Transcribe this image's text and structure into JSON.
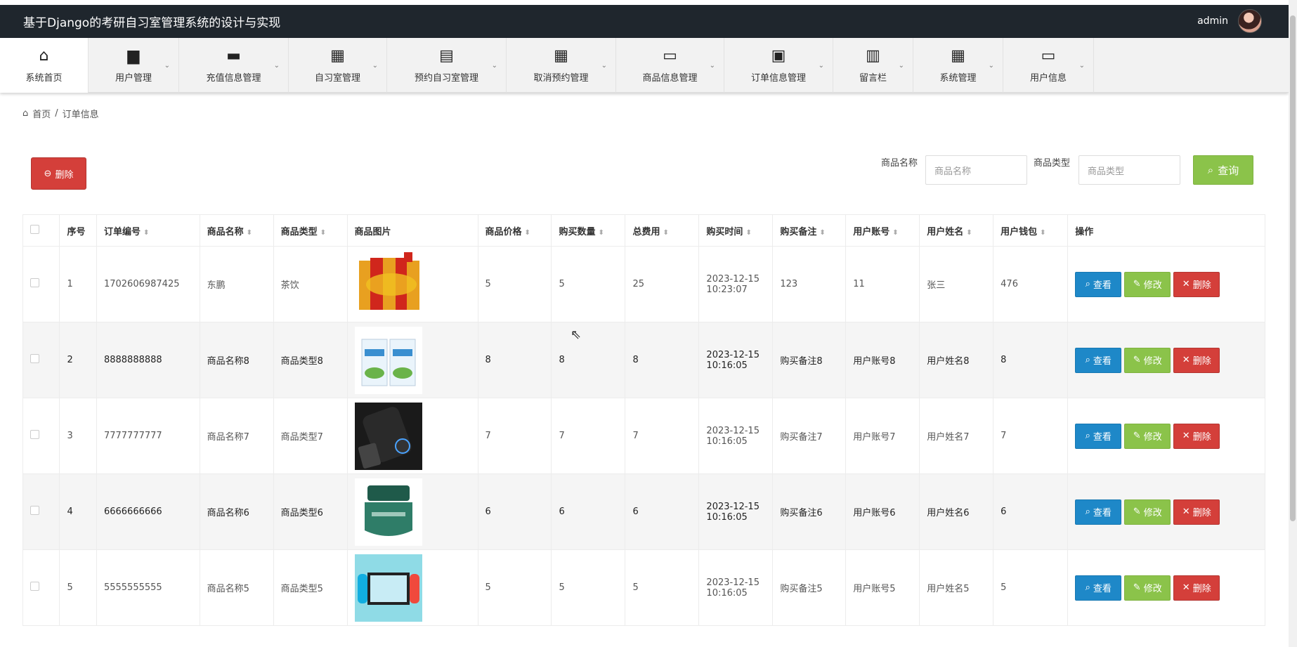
{
  "app": {
    "title": "基于Django的考研自习室管理系统的设计与实现",
    "user": "admin"
  },
  "nav": [
    {
      "label": "系统首页",
      "icon": "home-icon",
      "glyph": "⌂",
      "width": 126
    },
    {
      "label": "用户管理",
      "icon": "briefcase-icon",
      "glyph": "▆",
      "width": 129
    },
    {
      "label": "充值信息管理",
      "icon": "wallet-icon",
      "glyph": "▬",
      "width": 156
    },
    {
      "label": "自习室管理",
      "icon": "grid-icon",
      "glyph": "▦",
      "width": 140
    },
    {
      "label": "预约自习室管理",
      "icon": "clipboard-icon",
      "glyph": "▤",
      "width": 170
    },
    {
      "label": "取消预约管理",
      "icon": "grid-icon",
      "glyph": "▦",
      "width": 156
    },
    {
      "label": "商品信息管理",
      "icon": "chat-icon",
      "glyph": "▭",
      "width": 154
    },
    {
      "label": "订单信息管理",
      "icon": "clipboard-check-icon",
      "glyph": "▣",
      "width": 155
    },
    {
      "label": "留言栏",
      "icon": "book-icon",
      "glyph": "▥",
      "width": 114
    },
    {
      "label": "系统管理",
      "icon": "grid-icon",
      "glyph": "▦",
      "width": 128
    },
    {
      "label": "用户信息",
      "icon": "card-icon",
      "glyph": "▭",
      "width": 129
    }
  ],
  "breadcrumb": {
    "home": "首页",
    "sep": "/",
    "current": "订单信息"
  },
  "toolbar": {
    "delete_label": "删除",
    "delete_icon": "⊖"
  },
  "search": {
    "name_label": "商品名称",
    "name_placeholder": "商品名称",
    "type_label": "商品类型",
    "type_placeholder": "商品类型",
    "query_label": "查询"
  },
  "table": {
    "headers": [
      "序号",
      "订单编号",
      "商品名称",
      "商品类型",
      "商品图片",
      "商品价格",
      "购买数量",
      "总费用",
      "购买时间",
      "购买备注",
      "用户账号",
      "用户姓名",
      "用户钱包",
      "操作"
    ],
    "rows": [
      {
        "idx": "1",
        "order_no": "1702606987425",
        "name": "东鹏",
        "type": "茶饮",
        "price": "5",
        "qty": "5",
        "total": "25",
        "time": "2023-12-15 10:23:07",
        "note": "123",
        "account": "11",
        "username": "张三",
        "wallet": "476",
        "img": "drinks"
      },
      {
        "idx": "2",
        "order_no": "8888888888",
        "name": "商品名称8",
        "type": "商品类型8",
        "price": "8",
        "qty": "8",
        "total": "8",
        "time": "2023-12-15 10:16:05",
        "note": "购买备注8",
        "account": "用户账号8",
        "username": "用户姓名8",
        "wallet": "8",
        "img": "milk"
      },
      {
        "idx": "3",
        "order_no": "7777777777",
        "name": "商品名称7",
        "type": "商品类型7",
        "price": "7",
        "qty": "7",
        "total": "7",
        "time": "2023-12-15 10:16:05",
        "note": "购买备注7",
        "account": "用户账号7",
        "username": "用户姓名7",
        "wallet": "7",
        "img": "speaker"
      },
      {
        "idx": "4",
        "order_no": "6666666666",
        "name": "商品名称6",
        "type": "商品类型6",
        "price": "6",
        "qty": "6",
        "total": "6",
        "time": "2023-12-15 10:16:05",
        "note": "购买备注6",
        "account": "用户账号6",
        "username": "用户姓名6",
        "wallet": "6",
        "img": "cream"
      },
      {
        "idx": "5",
        "order_no": "5555555555",
        "name": "商品名称5",
        "type": "商品类型5",
        "price": "5",
        "qty": "5",
        "total": "5",
        "time": "2023-12-15 10:16:05",
        "note": "购买备注5",
        "account": "用户账号5",
        "username": "用户姓名5",
        "wallet": "5",
        "img": "switch"
      }
    ],
    "actions": {
      "view": "查看",
      "edit": "修改",
      "delete": "删除"
    }
  },
  "colors": {
    "topbar": "#1f262d",
    "danger": "#d43f3a",
    "success": "#8bc34a",
    "primary": "#1e88c8"
  }
}
